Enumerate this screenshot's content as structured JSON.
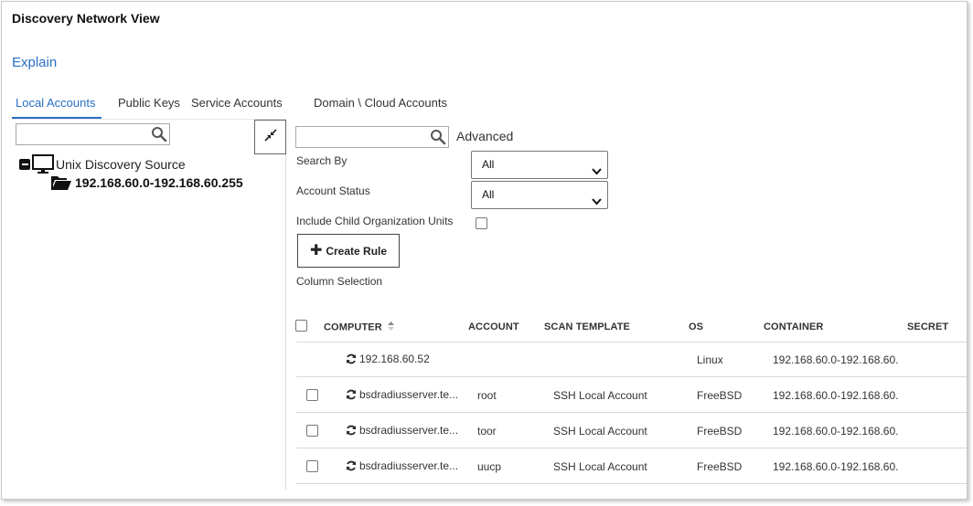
{
  "page": {
    "title": "Discovery Network View",
    "explain_link": "Explain"
  },
  "tabs": [
    {
      "label": "Local Accounts",
      "active": true
    },
    {
      "label": "Public Keys",
      "active": false
    },
    {
      "label": "Service Accounts",
      "active": false
    },
    {
      "label": "Domain \\ Cloud Accounts",
      "active": false
    }
  ],
  "tree": {
    "search_value": "",
    "root": {
      "label": "Unix Discovery Source",
      "icon": "monitor-icon",
      "expanded": true
    },
    "child": {
      "label": "192.168.60.0-192.168.60.255",
      "icon": "open-folder-icon"
    }
  },
  "filters": {
    "search_value": "",
    "advanced_label": "Advanced",
    "search_by": {
      "label": "Search By",
      "value": "All"
    },
    "account_status": {
      "label": "Account Status",
      "value": "All"
    },
    "include_child": {
      "label": "Include Child Organization Units",
      "checked": false
    },
    "create_rule_label": "Create Rule",
    "column_selection_label": "Column Selection"
  },
  "table": {
    "headers": {
      "computer": "COMPUTER",
      "account": "ACCOUNT",
      "scan_template": "SCAN TEMPLATE",
      "os": "OS",
      "container": "CONTAINER",
      "secret": "SECRET"
    },
    "rows": [
      {
        "computer": "192.168.60.52",
        "account": "",
        "scan_template": "",
        "os": "Linux",
        "container": "192.168.60.0-192.168.60.",
        "has_checkbox": false
      },
      {
        "computer": "bsdradiusserver.te...",
        "account": "root",
        "scan_template": "SSH Local Account",
        "os": "FreeBSD",
        "container": "192.168.60.0-192.168.60.",
        "has_checkbox": true
      },
      {
        "computer": "bsdradiusserver.te...",
        "account": "toor",
        "scan_template": "SSH Local Account",
        "os": "FreeBSD",
        "container": "192.168.60.0-192.168.60.",
        "has_checkbox": true
      },
      {
        "computer": "bsdradiusserver.te...",
        "account": "uucp",
        "scan_template": "SSH Local Account",
        "os": "FreeBSD",
        "container": "192.168.60.0-192.168.60.",
        "has_checkbox": true
      }
    ]
  },
  "colors": {
    "accent": "#2a6fc4",
    "text": "#333333",
    "border": "#a9a9a9"
  }
}
